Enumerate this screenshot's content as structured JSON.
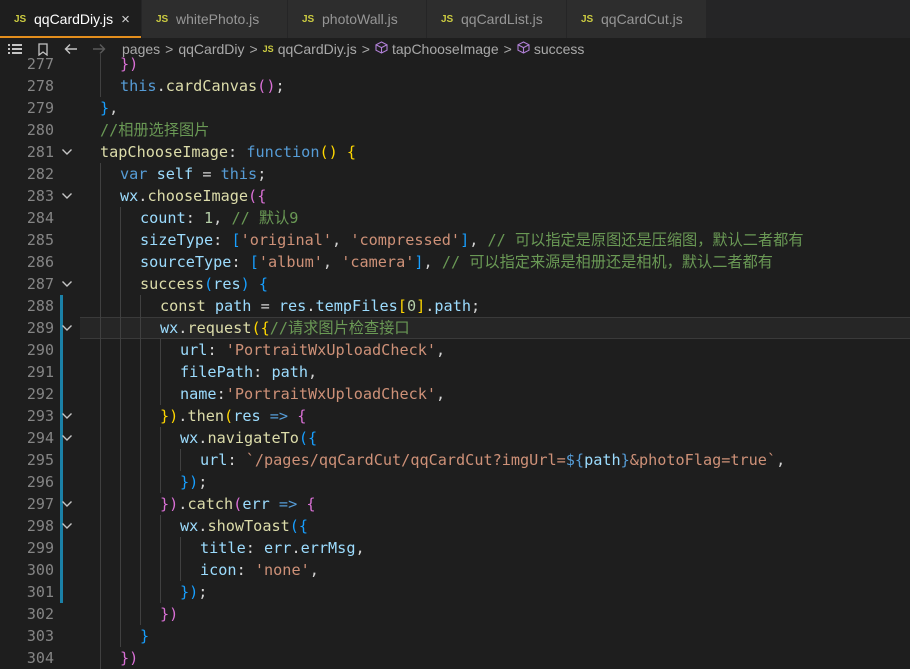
{
  "tabs": [
    {
      "label": "qqCardDiy.js",
      "active": true,
      "close": "×"
    },
    {
      "label": "whitePhoto.js",
      "active": false
    },
    {
      "label": "photoWall.js",
      "active": false
    },
    {
      "label": "qqCardList.js",
      "active": false
    },
    {
      "label": "qqCardCut.js",
      "active": false
    }
  ],
  "file_badge": "JS",
  "breadcrumb": {
    "items": [
      "pages",
      "qqCardDiy",
      "qqCardDiy.js",
      "tapChooseImage",
      "success"
    ],
    "separator": ">"
  },
  "icons": {
    "list": "list-icon",
    "bookmark": "bookmark-icon",
    "back": "arrow-left-icon",
    "forward": "arrow-right-icon",
    "fold": "chevron-down-icon",
    "symbol": "method-cube-icon"
  },
  "colors": {
    "accent_tab": "#e38e1d",
    "change_bar": "#1b81a8",
    "editor_bg": "#1e1e1e"
  },
  "editor": {
    "lines": [
      {
        "n": "277",
        "fold": false,
        "indent": 2,
        "tokens": [
          [
            "p2",
            "})"
          ]
        ]
      },
      {
        "n": "278",
        "fold": false,
        "indent": 2,
        "tokens": [
          [
            "k",
            "this"
          ],
          [
            "op",
            "."
          ],
          [
            "fn",
            "cardCanvas"
          ],
          [
            "p2",
            "()"
          ],
          [
            "op",
            ";"
          ]
        ]
      },
      {
        "n": "279",
        "fold": false,
        "indent": 1,
        "tokens": [
          [
            "p3",
            "}"
          ],
          [
            "op",
            ","
          ]
        ]
      },
      {
        "n": "280",
        "fold": false,
        "indent": 1,
        "tokens": [
          [
            "cmt",
            "//相册选择图片"
          ]
        ]
      },
      {
        "n": "281",
        "fold": true,
        "indent": 1,
        "tokens": [
          [
            "fn",
            "tapChooseImage"
          ],
          [
            "op",
            ": "
          ],
          [
            "k",
            "function"
          ],
          [
            "p1",
            "()"
          ],
          [
            "op",
            " "
          ],
          [
            "p1",
            "{"
          ]
        ]
      },
      {
        "n": "282",
        "fold": false,
        "indent": 2,
        "tokens": [
          [
            "k",
            "var"
          ],
          [
            "op",
            " "
          ],
          [
            "var",
            "self"
          ],
          [
            "op",
            " = "
          ],
          [
            "k",
            "this"
          ],
          [
            "op",
            ";"
          ]
        ]
      },
      {
        "n": "283",
        "fold": true,
        "indent": 2,
        "tokens": [
          [
            "var",
            "wx"
          ],
          [
            "op",
            "."
          ],
          [
            "fn",
            "chooseImage"
          ],
          [
            "p2",
            "({"
          ]
        ]
      },
      {
        "n": "284",
        "fold": false,
        "indent": 3,
        "tokens": [
          [
            "prop",
            "count"
          ],
          [
            "op",
            ": "
          ],
          [
            "num",
            "1"
          ],
          [
            "op",
            ", "
          ],
          [
            "cmt",
            "// 默认9"
          ]
        ]
      },
      {
        "n": "285",
        "fold": false,
        "indent": 3,
        "tokens": [
          [
            "prop",
            "sizeType"
          ],
          [
            "op",
            ": "
          ],
          [
            "p3",
            "["
          ],
          [
            "str",
            "'original'"
          ],
          [
            "op",
            ", "
          ],
          [
            "str",
            "'compressed'"
          ],
          [
            "p3",
            "]"
          ],
          [
            "op",
            ", "
          ],
          [
            "cmt",
            "// 可以指定是原图还是压缩图，默认二者都有"
          ]
        ]
      },
      {
        "n": "286",
        "fold": false,
        "indent": 3,
        "tokens": [
          [
            "prop",
            "sourceType"
          ],
          [
            "op",
            ": "
          ],
          [
            "p3",
            "["
          ],
          [
            "str",
            "'album'"
          ],
          [
            "op",
            ", "
          ],
          [
            "str",
            "'camera'"
          ],
          [
            "p3",
            "]"
          ],
          [
            "op",
            ", "
          ],
          [
            "cmt",
            "// 可以指定来源是相册还是相机，默认二者都有"
          ]
        ]
      },
      {
        "n": "287",
        "fold": true,
        "indent": 3,
        "tokens": [
          [
            "fn",
            "success"
          ],
          [
            "p3",
            "("
          ],
          [
            "var",
            "res"
          ],
          [
            "p3",
            ")"
          ],
          [
            "op",
            " "
          ],
          [
            "p3",
            "{"
          ]
        ]
      },
      {
        "n": "288",
        "fold": false,
        "indent": 4,
        "tokens": [
          [
            "fn",
            "const"
          ],
          [
            "op",
            " "
          ],
          [
            "var",
            "path"
          ],
          [
            "op",
            " = "
          ],
          [
            "var",
            "res"
          ],
          [
            "op",
            "."
          ],
          [
            "var",
            "tempFiles"
          ],
          [
            "p1",
            "["
          ],
          [
            "num",
            "0"
          ],
          [
            "p1",
            "]"
          ],
          [
            "op",
            "."
          ],
          [
            "var",
            "path"
          ],
          [
            "op",
            ";"
          ]
        ]
      },
      {
        "n": "289",
        "fold": true,
        "indent": 4,
        "hl": true,
        "tokens": [
          [
            "var",
            "wx"
          ],
          [
            "op",
            "."
          ],
          [
            "fn",
            "request"
          ],
          [
            "p1",
            "({"
          ],
          [
            "cmt",
            "//请求图片检查接口"
          ]
        ]
      },
      {
        "n": "290",
        "fold": false,
        "indent": 5,
        "tokens": [
          [
            "prop",
            "url"
          ],
          [
            "op",
            ": "
          ],
          [
            "str",
            "'PortraitWxUploadCheck'"
          ],
          [
            "op",
            ","
          ]
        ]
      },
      {
        "n": "291",
        "fold": false,
        "indent": 5,
        "tokens": [
          [
            "prop",
            "filePath"
          ],
          [
            "op",
            ": "
          ],
          [
            "var",
            "path"
          ],
          [
            "op",
            ","
          ]
        ]
      },
      {
        "n": "292",
        "fold": false,
        "indent": 5,
        "tokens": [
          [
            "prop",
            "name"
          ],
          [
            "op",
            ":"
          ],
          [
            "str",
            "'PortraitWxUploadCheck'"
          ],
          [
            "op",
            ","
          ]
        ]
      },
      {
        "n": "293",
        "fold": true,
        "indent": 4,
        "tokens": [
          [
            "p1",
            "})"
          ],
          [
            "op",
            "."
          ],
          [
            "fn",
            "then"
          ],
          [
            "p1",
            "("
          ],
          [
            "var",
            "res"
          ],
          [
            "op",
            " "
          ],
          [
            "k",
            "=>"
          ],
          [
            "op",
            " "
          ],
          [
            "p2",
            "{"
          ]
        ]
      },
      {
        "n": "294",
        "fold": true,
        "indent": 5,
        "tokens": [
          [
            "var",
            "wx"
          ],
          [
            "op",
            "."
          ],
          [
            "fn",
            "navigateTo"
          ],
          [
            "p3",
            "({"
          ]
        ]
      },
      {
        "n": "295",
        "fold": false,
        "indent": 6,
        "tokens": [
          [
            "prop",
            "url"
          ],
          [
            "op",
            ": "
          ],
          [
            "str",
            "`/pages/qqCardCut/qqCardCut?imgUrl="
          ],
          [
            "k",
            "${"
          ],
          [
            "var",
            "path"
          ],
          [
            "k",
            "}"
          ],
          [
            "str",
            "&photoFlag=true`"
          ],
          [
            "op",
            ","
          ]
        ]
      },
      {
        "n": "296",
        "fold": false,
        "indent": 5,
        "tokens": [
          [
            "p3",
            "})"
          ],
          [
            "op",
            ";"
          ]
        ]
      },
      {
        "n": "297",
        "fold": true,
        "indent": 4,
        "tokens": [
          [
            "p2",
            "})"
          ],
          [
            "op",
            "."
          ],
          [
            "fn",
            "catch"
          ],
          [
            "p2",
            "("
          ],
          [
            "var",
            "err"
          ],
          [
            "op",
            " "
          ],
          [
            "k",
            "=>"
          ],
          [
            "op",
            " "
          ],
          [
            "p2",
            "{"
          ]
        ]
      },
      {
        "n": "298",
        "fold": true,
        "indent": 5,
        "tokens": [
          [
            "var",
            "wx"
          ],
          [
            "op",
            "."
          ],
          [
            "fn",
            "showToast"
          ],
          [
            "p3",
            "({"
          ]
        ]
      },
      {
        "n": "299",
        "fold": false,
        "indent": 6,
        "tokens": [
          [
            "prop",
            "title"
          ],
          [
            "op",
            ": "
          ],
          [
            "var",
            "err"
          ],
          [
            "op",
            "."
          ],
          [
            "var",
            "errMsg"
          ],
          [
            "op",
            ","
          ]
        ]
      },
      {
        "n": "300",
        "fold": false,
        "indent": 6,
        "tokens": [
          [
            "prop",
            "icon"
          ],
          [
            "op",
            ": "
          ],
          [
            "str",
            "'none'"
          ],
          [
            "op",
            ","
          ]
        ]
      },
      {
        "n": "301",
        "fold": false,
        "indent": 5,
        "tokens": [
          [
            "p3",
            "})"
          ],
          [
            "op",
            ";"
          ]
        ]
      },
      {
        "n": "302",
        "fold": false,
        "indent": 4,
        "tokens": [
          [
            "p2",
            "})"
          ]
        ]
      },
      {
        "n": "303",
        "fold": false,
        "indent": 3,
        "tokens": [
          [
            "p3",
            "}"
          ]
        ]
      },
      {
        "n": "304",
        "fold": false,
        "indent": 2,
        "tokens": [
          [
            "p2",
            "})"
          ]
        ]
      }
    ]
  }
}
